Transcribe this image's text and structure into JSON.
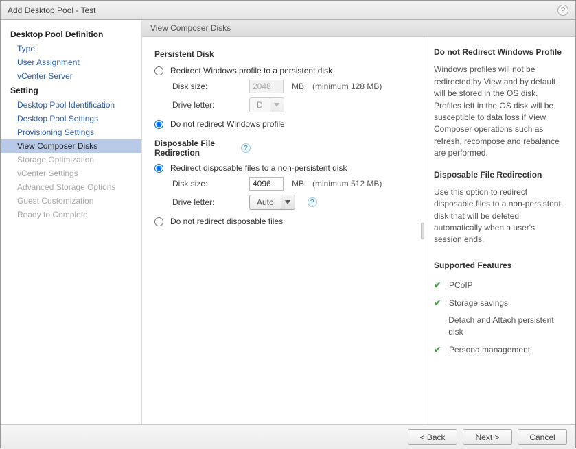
{
  "window": {
    "title": "Add Desktop Pool - Test"
  },
  "sidebar": {
    "sections": [
      {
        "label": "Desktop Pool Definition",
        "items": [
          {
            "label": "Type",
            "state": "link"
          },
          {
            "label": "User Assignment",
            "state": "link"
          },
          {
            "label": "vCenter Server",
            "state": "link"
          }
        ]
      },
      {
        "label": "Setting",
        "items": [
          {
            "label": "Desktop Pool Identification",
            "state": "link"
          },
          {
            "label": "Desktop Pool Settings",
            "state": "link"
          },
          {
            "label": "Provisioning Settings",
            "state": "link"
          },
          {
            "label": "View Composer Disks",
            "state": "selected"
          },
          {
            "label": "Storage Optimization",
            "state": "disabled"
          },
          {
            "label": "vCenter Settings",
            "state": "disabled"
          },
          {
            "label": "Advanced Storage Options",
            "state": "disabled"
          },
          {
            "label": "Guest Customization",
            "state": "disabled"
          },
          {
            "label": "Ready to Complete",
            "state": "disabled"
          }
        ]
      }
    ]
  },
  "panel": {
    "title": "View Composer Disks"
  },
  "form": {
    "persistent": {
      "heading": "Persistent Disk",
      "opt_redirect": "Redirect Windows profile to a persistent disk",
      "opt_no_redirect": "Do not redirect Windows profile",
      "selected": "no_redirect",
      "disk_size_label": "Disk size:",
      "disk_size_value": "2048",
      "disk_size_unit": "MB",
      "disk_size_hint": "(minimum 128 MB)",
      "drive_letter_label": "Drive letter:",
      "drive_letter_value": "D"
    },
    "disposable": {
      "heading": "Disposable File Redirection",
      "opt_redirect": "Redirect disposable files to a non-persistent disk",
      "opt_no_redirect": "Do not redirect disposable files",
      "selected": "redirect",
      "disk_size_label": "Disk size:",
      "disk_size_value": "4096",
      "disk_size_unit": "MB",
      "disk_size_hint": "(minimum 512 MB)",
      "drive_letter_label": "Drive letter:",
      "drive_letter_value": "Auto"
    }
  },
  "info": {
    "h1": "Do not Redirect Windows Profile",
    "p1": "Windows profiles will not be redirected by View and by default will be stored in the OS disk. Profiles left in the OS disk will be susceptible to data loss if View Composer operations such as refresh, recompose and rebalance are performed.",
    "h2": "Disposable File Redirection",
    "p2": "Use this option to redirect disposable files to a non-persistent disk that will be deleted automatically when a user's session ends.",
    "h3": "Supported Features",
    "features": [
      {
        "check": true,
        "label": "PCoIP"
      },
      {
        "check": true,
        "label": "Storage savings"
      },
      {
        "check": false,
        "label": "Detach and Attach persistent disk"
      },
      {
        "check": true,
        "label": "Persona management"
      }
    ]
  },
  "footer": {
    "back": "< Back",
    "next": "Next >",
    "cancel": "Cancel"
  }
}
